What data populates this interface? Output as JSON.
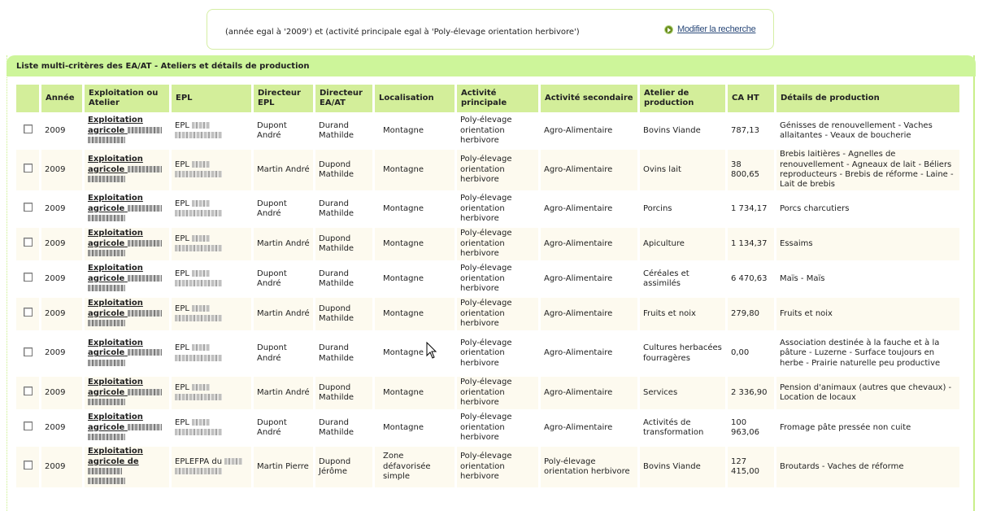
{
  "criteria": {
    "text": "(année egal à '2009') et (activité principale egal à 'Poly-élevage orientation herbivore')",
    "modify_label": "Modifier la recherche",
    "modify_icon": "arrow-right-circle-icon"
  },
  "panel": {
    "title": "Liste multi-critères des EA/AT - Ateliers et détails de production"
  },
  "table": {
    "headers": [
      "",
      "Année",
      "Exploitation ou Atelier",
      "EPL",
      "Directeur EPL",
      "Directeur EA/AT",
      "Localisation",
      "Activité principale",
      "Activité secondaire",
      "Atelier de production",
      "CA HT",
      "Détails de production"
    ],
    "rows": [
      {
        "annee": "2009",
        "expl": "Exploitation agricole",
        "epl": "EPL",
        "dir_epl": "Dupont André",
        "dir_ea": "Durand Mathilde",
        "loc": "Montagne",
        "act_p": "Poly-élevage orientation herbivore",
        "act_s": "Agro-Alimentaire",
        "atelier": "Bovins Viande",
        "ca": "787,13",
        "details": "Génisses de renouvellement  - Vaches allaitantes  - Veaux de boucherie"
      },
      {
        "annee": "2009",
        "expl": "Exploitation agricole",
        "epl": "EPL",
        "dir_epl": "Martin André",
        "dir_ea": "Dupond Mathilde",
        "loc": "Montagne",
        "act_p": "Poly-élevage orientation herbivore",
        "act_s": "Agro-Alimentaire",
        "atelier": "Ovins lait",
        "ca": "38 800,65",
        "details": "Brebis laitières  - Agnelles de renouvellement  - Agneaux de lait  - Béliers reproducteurs  - Brebis de réforme  - Laine  - Lait de brebis"
      },
      {
        "annee": "2009",
        "expl": "Exploitation agricole",
        "epl": "EPL",
        "dir_epl": "Dupont André",
        "dir_ea": "Durand Mathilde",
        "loc": "Montagne",
        "act_p": "Poly-élevage orientation herbivore",
        "act_s": "Agro-Alimentaire",
        "atelier": "Porcins",
        "ca": "1 734,17",
        "details": "Porcs charcutiers"
      },
      {
        "annee": "2009",
        "expl": "Exploitation agricole",
        "epl": "EPL",
        "dir_epl": "Martin André",
        "dir_ea": "Dupond Mathilde",
        "loc": "Montagne",
        "act_p": "Poly-élevage orientation herbivore",
        "act_s": "Agro-Alimentaire",
        "atelier": "Apiculture",
        "ca": "1 134,37",
        "details": "Essaims"
      },
      {
        "annee": "2009",
        "expl": "Exploitation agricole",
        "epl": "EPL",
        "dir_epl": "Dupont André",
        "dir_ea": "Durand Mathilde",
        "loc": "Montagne",
        "act_p": "Poly-élevage orientation herbivore",
        "act_s": "Agro-Alimentaire",
        "atelier": "Céréales et assimilés",
        "ca": "6 470,63",
        "details": "Maïs  - Maïs"
      },
      {
        "annee": "2009",
        "expl": "Exploitation agricole",
        "epl": "EPL",
        "dir_epl": "Martin André",
        "dir_ea": "Dupond Mathilde",
        "loc": "Montagne",
        "act_p": "Poly-élevage orientation herbivore",
        "act_s": "Agro-Alimentaire",
        "atelier": "Fruits et noix",
        "ca": "279,80",
        "details": "Fruits et noix"
      },
      {
        "annee": "2009",
        "expl": "Exploitation agricole",
        "epl": "EPL",
        "dir_epl": "Dupont André",
        "dir_ea": "Durand Mathilde",
        "loc": "Montagne",
        "act_p": "Poly-élevage orientation herbivore",
        "act_s": "Agro-Alimentaire",
        "atelier": "Cultures herbacées fourragères",
        "ca": "0,00",
        "details": "Association destinée à la fauche et à la pâture  - Luzerne  - Surface toujours en herbe  - Prairie naturelle peu productive"
      },
      {
        "annee": "2009",
        "expl": "Exploitation agricole",
        "epl": "EPL",
        "dir_epl": "Martin André",
        "dir_ea": "Dupond Mathilde",
        "loc": "Montagne",
        "act_p": "Poly-élevage orientation herbivore",
        "act_s": "Agro-Alimentaire",
        "atelier": "Services",
        "ca": "2 336,90",
        "details": "Pension d'animaux (autres que chevaux)  - Location de locaux"
      },
      {
        "annee": "2009",
        "expl": "Exploitation agricole",
        "epl": "EPL",
        "dir_epl": "Dupont André",
        "dir_ea": "Durand Mathilde",
        "loc": "Montagne",
        "act_p": "Poly-élevage orientation herbivore",
        "act_s": "Agro-Alimentaire",
        "atelier": "Activités de transformation",
        "ca": "100 963,06",
        "details": "Fromage pâte pressée non cuite"
      },
      {
        "annee": "2009",
        "expl": "Exploitation agricole de",
        "epl": "EPLEFPA du",
        "dir_epl": "Martin Pierre",
        "dir_ea": "Dupond Jérôme",
        "loc": "Zone défavorisée simple",
        "act_p": "Poly-élevage orientation herbivore",
        "act_s": "Poly-élevage orientation herbivore",
        "atelier": "Bovins Viande",
        "ca": "127 415,00",
        "details": "Broutards  - Vaches de réforme"
      }
    ]
  }
}
